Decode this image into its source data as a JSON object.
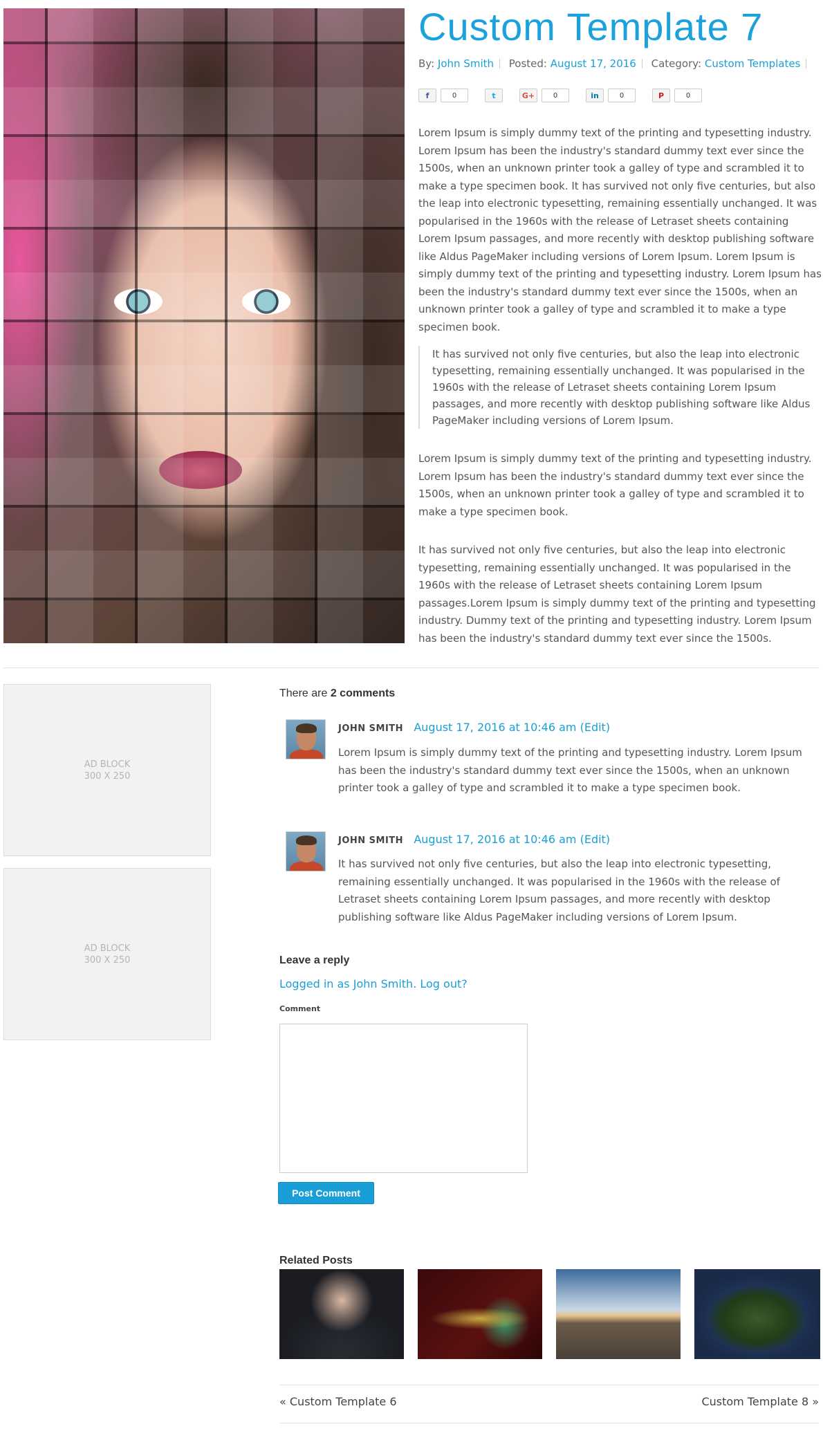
{
  "post": {
    "title": "Custom Template 7",
    "meta": {
      "by_label": "By:",
      "author": "John Smith",
      "posted_label": "Posted:",
      "date": "August 17, 2016",
      "category_label": "Category:",
      "category": "Custom Templates"
    },
    "share": [
      {
        "icon": "facebook-icon",
        "glyph": "f",
        "color": "#3b5998",
        "count": "0"
      },
      {
        "icon": "twitter-icon",
        "glyph": "t",
        "color": "#1da1f2",
        "count": ""
      },
      {
        "icon": "google-plus-icon",
        "glyph": "G+",
        "color": "#dd4b39",
        "count": "0"
      },
      {
        "icon": "linkedin-icon",
        "glyph": "in",
        "color": "#0077b5",
        "count": "0"
      },
      {
        "icon": "pinterest-icon",
        "glyph": "P",
        "color": "#cb2027",
        "count": "0"
      }
    ],
    "paragraphs": [
      "Lorem Ipsum is simply dummy text of the printing and typesetting industry. Lorem Ipsum has been the industry's standard dummy text ever since the 1500s, when an unknown printer took a galley of type and scrambled it to make a type specimen book. It has survived not only five centuries, but also the leap into electronic typesetting, remaining essentially unchanged. It was popularised in the 1960s with the release of Letraset sheets containing Lorem Ipsum passages, and more recently with desktop publishing software like Aldus PageMaker including versions of Lorem Ipsum. Lorem Ipsum is simply dummy text of the printing and typesetting industry. Lorem Ipsum has been the industry's standard dummy text ever since the 1500s, when an unknown printer took a galley of type and scrambled it to make a type specimen book.",
      "Lorem Ipsum is simply dummy text of the printing and typesetting industry. Lorem Ipsum has been the industry's standard dummy text ever since the 1500s, when an unknown printer took a galley of type and scrambled it to make a type specimen book.",
      "It has survived not only five centuries, but also the leap into electronic typesetting, remaining essentially unchanged. It was popularised in the 1960s with the release of Letraset sheets containing Lorem Ipsum passages.Lorem Ipsum is simply dummy text of the printing and typesetting industry. Dummy text of the printing and typesetting industry. Lorem Ipsum has been the industry's standard dummy text ever since the 1500s."
    ],
    "blockquote": "It has survived not only five centuries, but also the leap into electronic typesetting, remaining essentially unchanged. It was popularised in the 1960s with the release of Letraset sheets containing Lorem Ipsum passages, and more recently with desktop publishing software like Aldus PageMaker including versions of Lorem Ipsum."
  },
  "ads": [
    {
      "line1": "AD BLOCK",
      "line2": "300 X 250"
    },
    {
      "line1": "AD BLOCK",
      "line2": "300 X 250"
    }
  ],
  "comments": {
    "heading_prefix": "There are",
    "count": "2 comments",
    "items": [
      {
        "author": "JOHN SMITH",
        "date": "August 17, 2016 at 10:46 am",
        "edit": "(Edit)",
        "text": "Lorem Ipsum is simply dummy text of the printing and typesetting industry. Lorem Ipsum has been the industry's standard dummy text ever since the 1500s, when an unknown printer took a galley of type and scrambled it to make a type specimen book."
      },
      {
        "author": "JOHN SMITH",
        "date": "August 17, 2016 at 10:46 am",
        "edit": "(Edit)",
        "text": "It has survived not only five centuries, but also the leap into electronic typesetting, remaining essentially unchanged. It was popularised in the 1960s with the release of Letraset sheets containing Lorem Ipsum passages, and more recently with desktop publishing software like Aldus PageMaker including versions of Lorem Ipsum."
      }
    ]
  },
  "reply": {
    "heading": "Leave a reply",
    "logged_in_text": "Logged in as John Smith.",
    "logout_text": "Log out?",
    "comment_label": "Comment",
    "comment_value": "",
    "submit_label": "Post Comment"
  },
  "related": {
    "heading": "Related Posts"
  },
  "post_nav": {
    "prev": "« Custom Template 6",
    "next": "Custom Template 8 »"
  },
  "colors": {
    "accent": "#1ba1db",
    "button": "#1a9ed8"
  }
}
